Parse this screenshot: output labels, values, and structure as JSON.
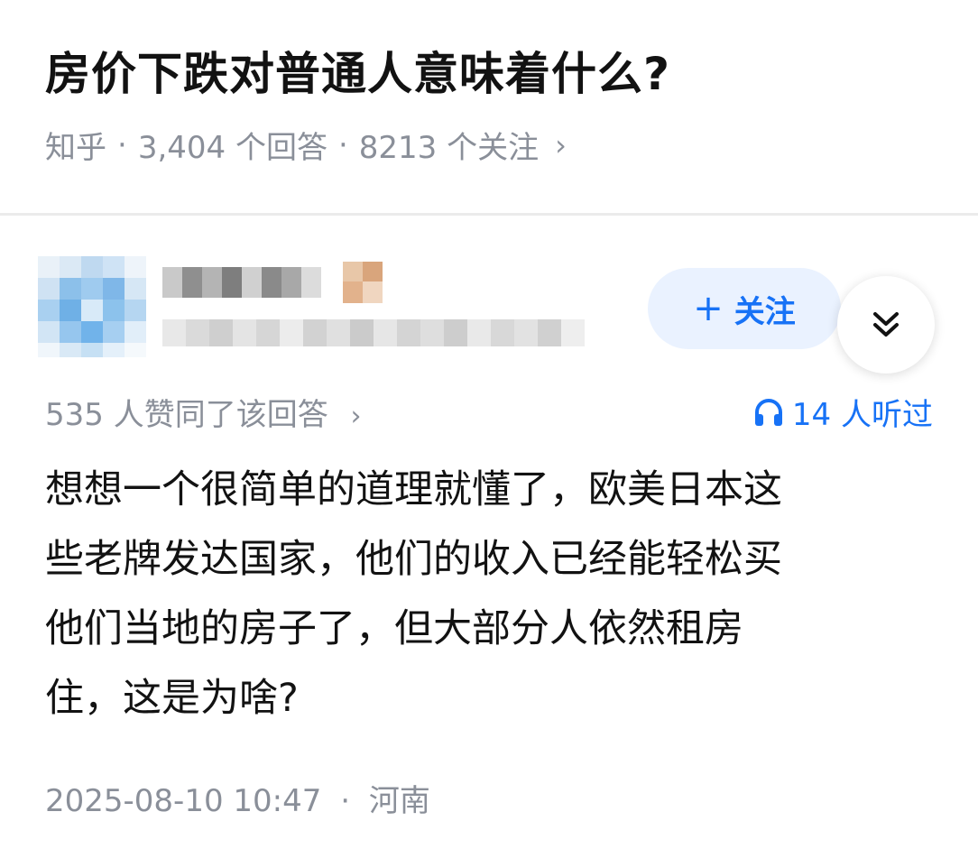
{
  "question": {
    "title": "房价下跌对普通人意味着什么?",
    "source": "知乎",
    "answer_count": "3,404 个回答",
    "follower_count": "8213 个关注",
    "separator": "·",
    "chevron": "›"
  },
  "author": {
    "follow_label": "关注",
    "follow_icon": "plus-icon",
    "expand_icon": "double-chevron-down-icon"
  },
  "answer": {
    "vote_text": "535 人赞同了该回答",
    "vote_chevron": "›",
    "listen_text": "14 人听过",
    "listen_icon": "headphones-icon",
    "lines": [
      "想想一个很简单的道理就懂了，欧美日本这",
      "些老牌发达国家，他们的收入已经能轻松买",
      "他们当地的房子了，但大部分人依然租房",
      "住，这是为啥?"
    ],
    "date": "2025-08-10 10:47",
    "separator": "·",
    "location": "河南"
  },
  "colors": {
    "accent": "#1772f6",
    "follow_bg": "#eaf2ff",
    "muted": "#8a8f99",
    "text": "#121212"
  }
}
